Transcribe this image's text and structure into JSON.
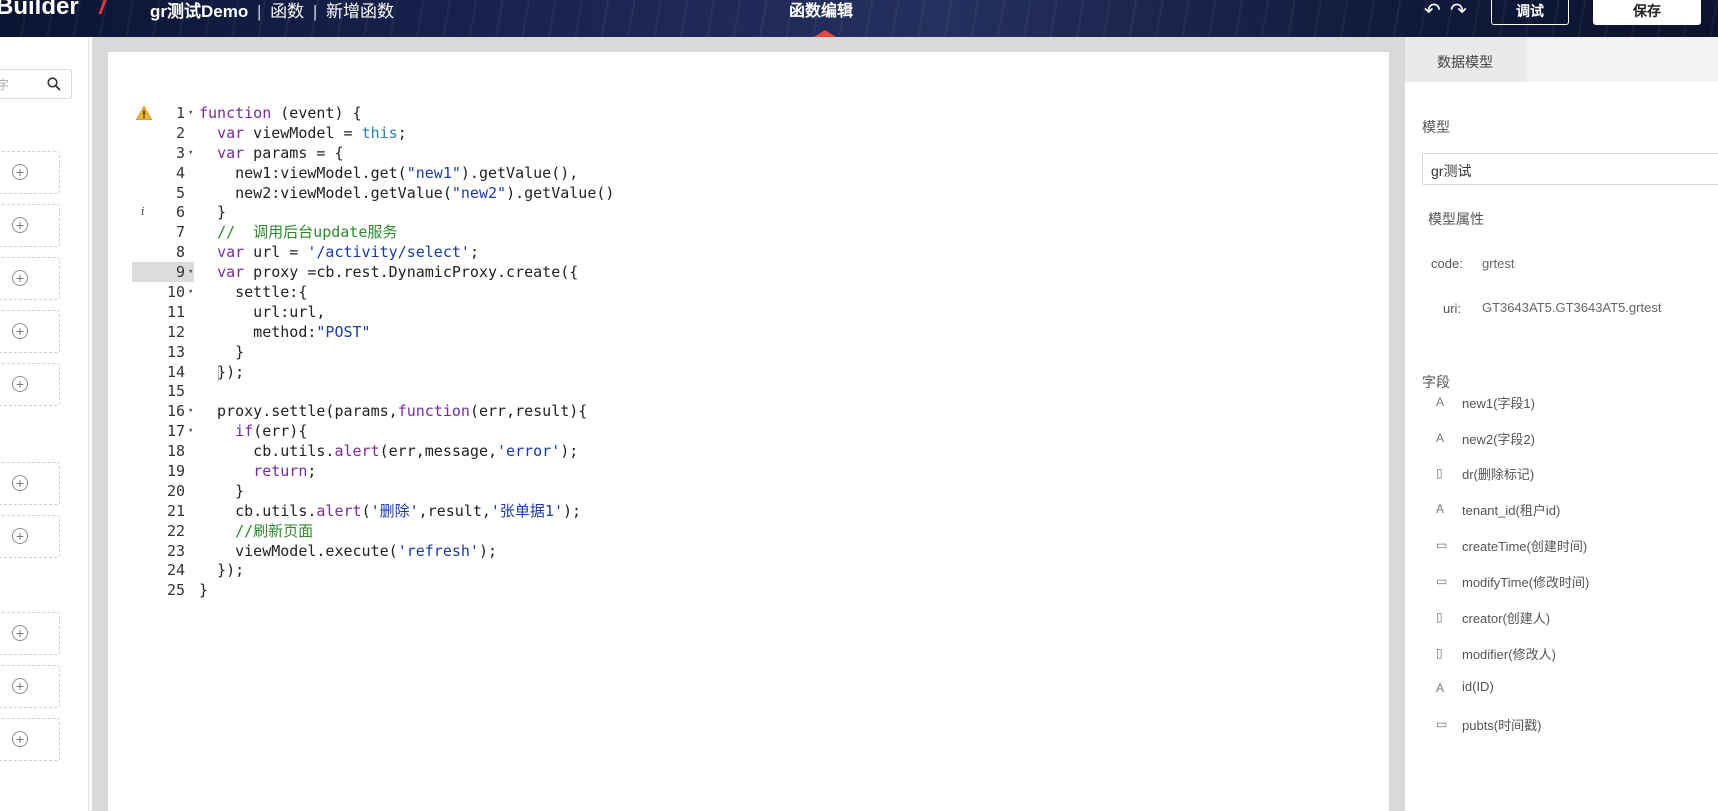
{
  "header": {
    "brand": "Builder",
    "app_name": "gr测试Demo",
    "sep": "|",
    "crumb1": "函数",
    "crumb2": "新增函数",
    "center_title": "函数编辑",
    "undo_glyph": "↶",
    "redo_glyph": "↷",
    "debug_label": "调试",
    "save_label": "保存"
  },
  "left_panel": {
    "search_placeholder": "字"
  },
  "editor": {
    "active_line": 9,
    "lines": [
      {
        "num": "1",
        "fold": "▾",
        "text": "function (event) {",
        "icon": "warning"
      },
      {
        "num": "2",
        "fold": "",
        "text": "  var viewModel = this;"
      },
      {
        "num": "3",
        "fold": "▾",
        "text": "  var params = {"
      },
      {
        "num": "4",
        "fold": "",
        "text": "    new1:viewModel.get(\"new1\").getValue(),"
      },
      {
        "num": "5",
        "fold": "",
        "text": "    new2:viewModel.getValue(\"new2\").getValue()"
      },
      {
        "num": "6",
        "fold": "",
        "text": "  }",
        "icon": "info"
      },
      {
        "num": "7",
        "fold": "",
        "text": "  //  调用后台update服务"
      },
      {
        "num": "8",
        "fold": "",
        "text": "  var url = '/activity/select';"
      },
      {
        "num": "9",
        "fold": "▾",
        "text": "  var proxy =cb.rest.DynamicProxy.create({"
      },
      {
        "num": "10",
        "fold": "▾",
        "text": "    settle:{"
      },
      {
        "num": "11",
        "fold": "",
        "text": "      url:url,"
      },
      {
        "num": "12",
        "fold": "",
        "text": "      method:\"POST\""
      },
      {
        "num": "13",
        "fold": "",
        "text": "    }"
      },
      {
        "num": "14",
        "fold": "",
        "text": "  });"
      },
      {
        "num": "15",
        "fold": "",
        "text": ""
      },
      {
        "num": "16",
        "fold": "▾",
        "text": "  proxy.settle(params,function(err,result){"
      },
      {
        "num": "17",
        "fold": "▾",
        "text": "    if(err){"
      },
      {
        "num": "18",
        "fold": "",
        "text": "      cb.utils.alert(err,message,'error');"
      },
      {
        "num": "19",
        "fold": "",
        "text": "      return;"
      },
      {
        "num": "20",
        "fold": "",
        "text": "    }"
      },
      {
        "num": "21",
        "fold": "",
        "text": "    cb.utils.alert('删除',result,'张单据1');"
      },
      {
        "num": "22",
        "fold": "",
        "text": "    //刷新页面"
      },
      {
        "num": "23",
        "fold": "",
        "text": "    viewModel.execute('refresh');"
      },
      {
        "num": "24",
        "fold": "",
        "text": "  });"
      },
      {
        "num": "25",
        "fold": "",
        "text": "}"
      }
    ],
    "colors": {
      "keyword": "#7a2aa0",
      "string": "#1a3aa8",
      "comment": "#2f8a2f",
      "this": "#2b7db3",
      "func": "#7a2aa0"
    }
  },
  "right_panel": {
    "tab_label": "数据模型",
    "model_label": "模型",
    "model_value": "gr测试",
    "attr_label": "模型属性",
    "code_key": "code:",
    "code_value": "grtest",
    "uri_key": "uri:",
    "uri_value": "GT3643AT5.GT3643AT5.grtest",
    "fields_label": "字段",
    "fields": [
      {
        "icon": "text",
        "label": "new1(字段1)"
      },
      {
        "icon": "text",
        "label": "new2(字段2)"
      },
      {
        "icon": "doc",
        "label": "dr(删除标记)"
      },
      {
        "icon": "text",
        "label": "tenant_id(租户id)"
      },
      {
        "icon": "date",
        "label": "createTime(创建时间)"
      },
      {
        "icon": "date",
        "label": "modifyTime(修改时间)"
      },
      {
        "icon": "doc",
        "label": "creator(创建人)"
      },
      {
        "icon": "doc",
        "label": "modifier(修改人)"
      },
      {
        "icon": "text",
        "label": "id(ID)"
      },
      {
        "icon": "date",
        "label": "pubts(时间戳)"
      }
    ]
  }
}
